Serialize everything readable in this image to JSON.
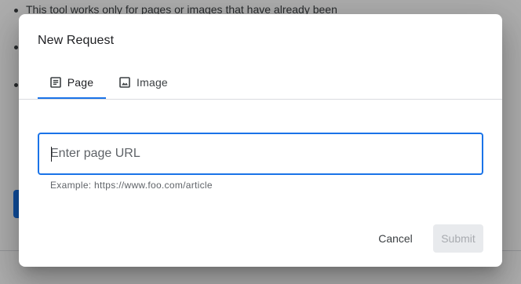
{
  "background": {
    "bullet_text": "This tool works only for pages or images that have already been"
  },
  "dialog": {
    "title": "New Request",
    "tabs": [
      {
        "label": "Page",
        "icon": "document-icon",
        "selected": true
      },
      {
        "label": "Image",
        "icon": "image-icon",
        "selected": false
      }
    ],
    "url_input": {
      "value": "",
      "placeholder": "Enter page URL",
      "helper": "Example: https://www.foo.com/article"
    },
    "actions": {
      "cancel_label": "Cancel",
      "submit_label": "Submit",
      "submit_enabled": false
    }
  },
  "colors": {
    "accent": "#1a73e8",
    "scrim": "rgba(0,0,0,0.32)",
    "disabled_bg": "#e8eaed"
  }
}
